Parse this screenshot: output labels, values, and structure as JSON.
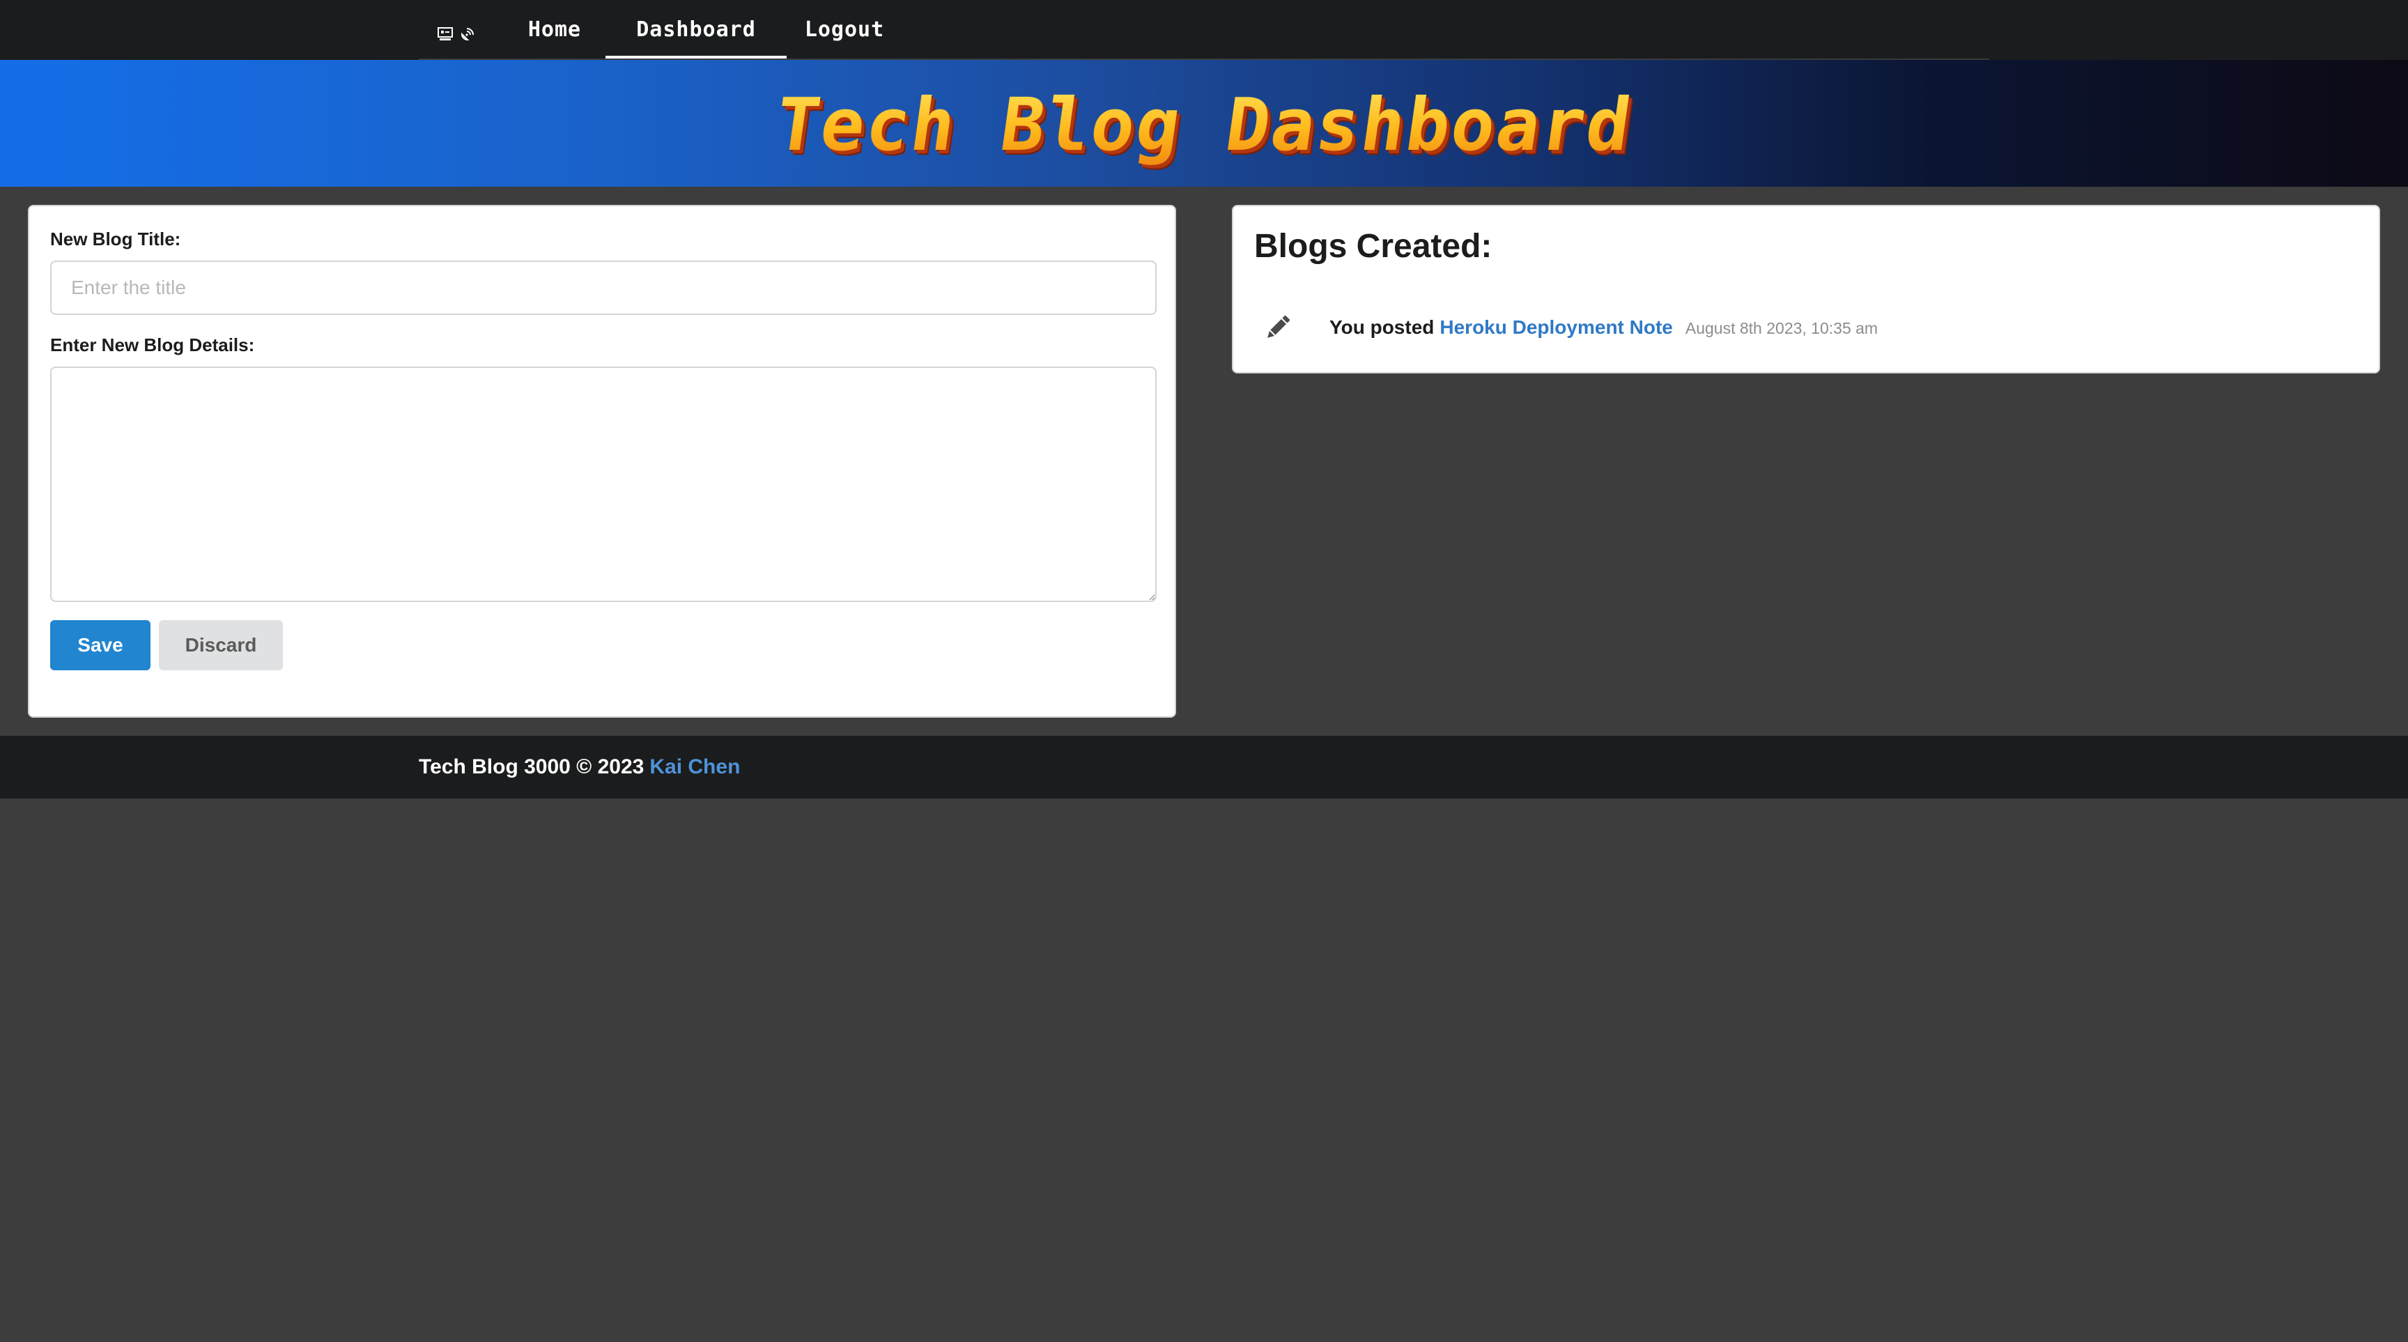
{
  "nav": {
    "logo_icons": [
      "computer-icon",
      "satellite-dish-icon"
    ],
    "items": [
      {
        "label": "Home"
      },
      {
        "label": "Dashboard",
        "active": true
      },
      {
        "label": "Logout"
      }
    ]
  },
  "banner": {
    "title": "Tech Blog Dashboard"
  },
  "form": {
    "title_label": "New Blog Title:",
    "title_placeholder": "Enter the title",
    "title_value": "",
    "details_label": "Enter New Blog Details:",
    "details_value": "",
    "save_label": "Save",
    "discard_label": "Discard"
  },
  "blogs": {
    "heading": "Blogs Created:",
    "events": [
      {
        "icon": "pencil-icon",
        "prefix": "You posted",
        "title": "Heroku Deployment Note",
        "date": "August 8th 2023, 10:35 am"
      }
    ]
  },
  "footer": {
    "text": "Tech Blog 3000 © 2023",
    "author": "Kai Chen"
  },
  "colors": {
    "page_bg": "#3d3d3d",
    "nav_bg": "#1b1c1d",
    "accent_blue": "#2185d0",
    "link_blue": "#2f79c5",
    "banner_gradient_start": "#156ee8",
    "banner_gradient_end": "#0c0a14",
    "banner_title": "#ffc21f"
  }
}
